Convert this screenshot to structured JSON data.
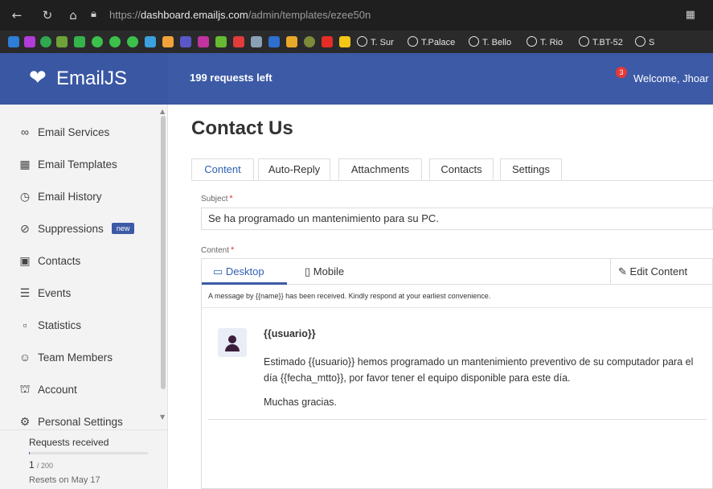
{
  "browser": {
    "url_prefix": "https://",
    "url_host": "dashboard.emailjs.com",
    "url_path": "/admin/templates/ezee50n",
    "bookmarks": [
      "T. Sur",
      "T.Palace",
      "T. Bello",
      "T. Rio",
      "T.BT-52",
      "S"
    ]
  },
  "header": {
    "logo": "EmailJS",
    "requests_left": "199 requests left",
    "notification_count": "3",
    "welcome": "Welcome, Jhoar"
  },
  "sidebar": {
    "items": [
      {
        "label": "Email Services",
        "icon": "plug-icon"
      },
      {
        "label": "Email Templates",
        "icon": "templates-icon"
      },
      {
        "label": "Email History",
        "icon": "history-icon"
      },
      {
        "label": "Suppressions",
        "icon": "block-icon",
        "badge": "new"
      },
      {
        "label": "Contacts",
        "icon": "contacts-icon"
      },
      {
        "label": "Events",
        "icon": "list-icon"
      },
      {
        "label": "Statistics",
        "icon": "chart-icon"
      },
      {
        "label": "Team Members",
        "icon": "team-icon"
      },
      {
        "label": "Account",
        "icon": "bank-icon"
      },
      {
        "label": "Personal Settings",
        "icon": "settings-icon"
      }
    ],
    "footer": {
      "requests_label": "Requests received",
      "requests_count": "1",
      "requests_total": "/ 200",
      "requests_fraction": 0.005,
      "resets": "Resets on May 17"
    }
  },
  "main": {
    "title": "Contact Us",
    "tabs": [
      "Content",
      "Auto-Reply",
      "Attachments",
      "Contacts",
      "Settings"
    ],
    "active_tab": "Content",
    "subject_label": "Subject",
    "subject_value": "Se ha programado un mantenimiento para su PC.",
    "content_label": "Content",
    "editor": {
      "desktop_label": "Desktop",
      "mobile_label": "Mobile",
      "edit_label": "Edit Content",
      "note": "A message by {{name}} has been received. Kindly respond at your earliest convenience.",
      "message_user": "{{usuario}}",
      "message_body": "Estimado {{usuario}} hemos programado un mantenimiento preventivo de su computador para el día {{fecha_mtto}}, por favor tener el equipo disponible para este día.",
      "message_thanks": "Muchas gracias."
    }
  },
  "colors": {
    "brand": "#3c5aa6",
    "link": "#2f5fb3",
    "required": "#e53935"
  }
}
